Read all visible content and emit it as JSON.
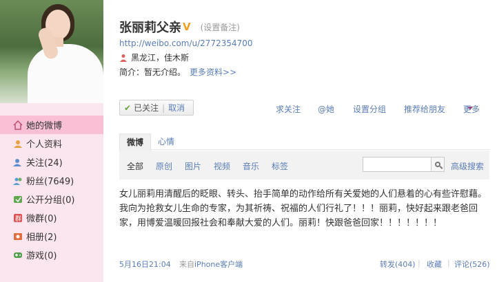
{
  "profile": {
    "name": "张丽莉父亲",
    "verified_badge": "V",
    "remark": "(设置备注)",
    "url": "http://weibo.com/u/2772354700",
    "location": "黑龙江，佳木斯",
    "intro_label": "简介：暂无介绍。",
    "more_info": "更多资料>>"
  },
  "follow": {
    "status": "已关注",
    "divider": "|",
    "cancel": "取消"
  },
  "actions": {
    "ask_follow": "求关注",
    "mention": "@她",
    "set_group": "设置分组",
    "recommend": "推荐给朋友",
    "more": "更多"
  },
  "nav": {
    "items": [
      {
        "label": "她的微博",
        "icon": "home-icon"
      },
      {
        "label": "个人资料",
        "icon": "profile-icon"
      },
      {
        "label": "关注(24)",
        "icon": "follow-icon"
      },
      {
        "label": "粉丝(7649)",
        "icon": "fans-icon"
      },
      {
        "label": "公开分组(0)",
        "icon": "group-icon"
      },
      {
        "label": "微群(0)",
        "icon": "weiqun-icon"
      },
      {
        "label": "相册(2)",
        "icon": "album-icon"
      },
      {
        "label": "游戏(0)",
        "icon": "game-icon"
      }
    ]
  },
  "tabs": {
    "weibo": "微博",
    "mood": "心情"
  },
  "filters": {
    "all": "全部",
    "original": "原创",
    "image": "图片",
    "video": "视频",
    "music": "音乐",
    "tag": "标签",
    "search_value": "",
    "advanced": "高级搜索"
  },
  "post": {
    "text": "女儿丽莉用清醒后的眨眼、转头、抬手简单的动作给所有关爱她的人们悬着的心有些许慰藉。我向为抢救女儿生命的专家，为其祈祷、祝福的人们行礼了！！！丽莉，快好起来跟老爸回家，用博爱温暖回报社会和奉献大爱的人们。丽莉！快跟爸爸回家！！！！！！！",
    "time": "5月16日21:04",
    "source_prefix": "来自",
    "source": "iPhone客户端",
    "repost": "转发(404)",
    "favorite": "收藏",
    "comment": "评论(526)",
    "sep": "|"
  },
  "colors": {
    "nav_bg": "#fbe5ee",
    "nav_active": "#f8bfd6",
    "link": "#5a7db8",
    "verified": "#f0a020"
  }
}
